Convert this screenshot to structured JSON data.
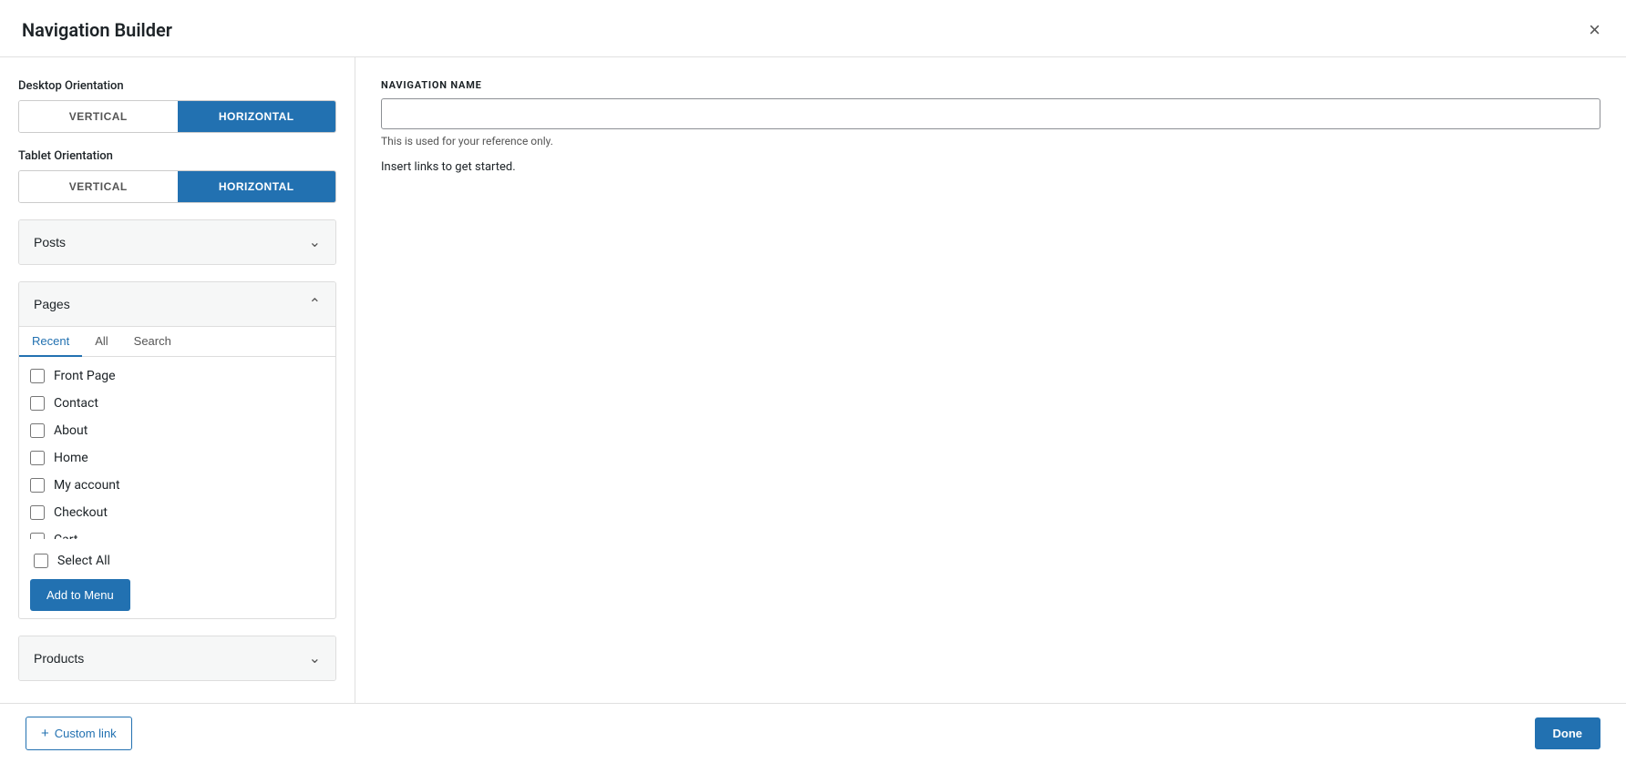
{
  "modal": {
    "title": "Navigation Builder",
    "close_label": "×"
  },
  "left": {
    "desktop_orientation_label": "Desktop Orientation",
    "tablet_orientation_label": "Tablet Orientation",
    "vertical_label": "VERTICAL",
    "horizontal_label": "HORIZONTAL",
    "posts_label": "Posts",
    "pages_label": "Pages",
    "tabs": [
      "Recent",
      "All",
      "Search"
    ],
    "pages_list": [
      "Front Page",
      "Contact",
      "About",
      "Home",
      "My account",
      "Checkout",
      "Cart"
    ],
    "select_all_label": "Select All",
    "add_to_menu_label": "Add to Menu",
    "products_label": "Products"
  },
  "right": {
    "nav_name_label": "NAVIGATION NAME",
    "nav_name_placeholder": "",
    "hint_text": "This is used for your reference only.",
    "insert_text": "Insert links to get started."
  },
  "footer": {
    "custom_link_label": "Custom link",
    "done_label": "Done"
  }
}
